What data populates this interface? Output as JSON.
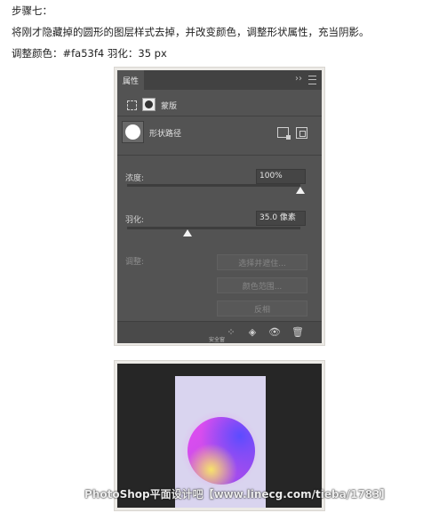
{
  "article": {
    "step_title": "步骤七：",
    "description": "将刚才隐藏掉的圆形的图层样式去掉，并改变颜色，调整形状属性，充当阴影。",
    "params": "调整颜色：#fa53f4 羽化：35 px"
  },
  "panel": {
    "tab_label": "属性",
    "collapse_glyph": "››",
    "mode_label": "蒙版",
    "path_label": "形状路径",
    "density_label": "浓度:",
    "density_value": "100%",
    "density_level": 1.0,
    "feather_label": "羽化:",
    "feather_value": "35.0 像素",
    "feather_level": 0.35,
    "refine_label": "调整:",
    "buttons": {
      "select_mask": "选择并遮住...",
      "color_range": "颜色范围...",
      "invert": "反相"
    },
    "footer_watermark": "安全窗"
  },
  "canvas": {
    "shadow_color": "#fa53f4",
    "background_color": "#262626"
  },
  "watermark": "PhotoShop平面设计吧【www.linecg.com/tieba/1783】"
}
